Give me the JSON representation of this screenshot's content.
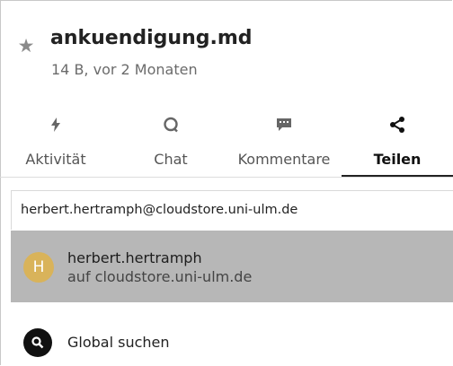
{
  "file": {
    "name": "ankuendigung.md",
    "meta": "14 B, vor 2 Monaten",
    "favorite_icon": "star-icon"
  },
  "tabs": [
    {
      "label": "Aktivität",
      "icon": "flash-icon",
      "active": false
    },
    {
      "label": "Chat",
      "icon": "chat-bubble-icon",
      "active": false
    },
    {
      "label": "Kommentare",
      "icon": "comment-icon",
      "active": false
    },
    {
      "label": "Teilen",
      "icon": "share-icon",
      "active": true
    }
  ],
  "share": {
    "search_value": "herbert.hertramph@cloudstore.uni-ulm.de",
    "suggestion": {
      "avatar_letter": "H",
      "name": "herbert.hertramph",
      "subtitle": "auf cloudstore.uni-ulm.de"
    },
    "global_search_label": "Global suchen"
  },
  "colors": {
    "accent_underline": "#222222",
    "avatar_bg": "#d9b35a",
    "suggestion_bg": "#b7b7b7"
  }
}
